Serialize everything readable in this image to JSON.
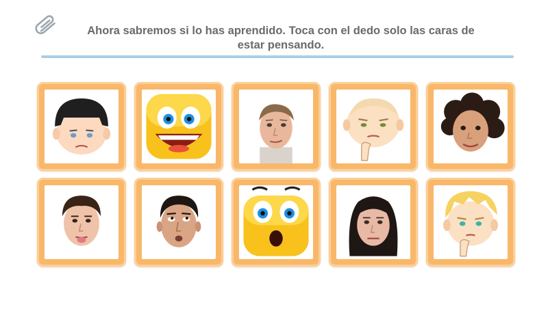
{
  "header": {
    "icon": "paperclip-icon",
    "instruction": "Ahora sabremos si lo has aprendido. Toca con el dedo solo las caras de estar pensando."
  },
  "colors": {
    "card_frame": "#f9b76a",
    "card_border": "#fccf96",
    "divider": "#a9cde6",
    "instruction_text": "#6a6a6a"
  },
  "cards": [
    {
      "image": "cartoon-boy-black-hair-worried"
    },
    {
      "image": "yellow-emoji-big-smile"
    },
    {
      "image": "blond-man-looking-up-thinking"
    },
    {
      "image": "cartoon-bald-baby-thinking-hand-on-chin"
    },
    {
      "image": "curly-haired-girl-smiling"
    },
    {
      "image": "boy-sticking-out-tongue"
    },
    {
      "image": "man-looking-up-thinking"
    },
    {
      "image": "yellow-emoji-surprised"
    },
    {
      "image": "woman-serious-face"
    },
    {
      "image": "cartoon-blond-boy-thinking-hand-on-chin"
    }
  ]
}
